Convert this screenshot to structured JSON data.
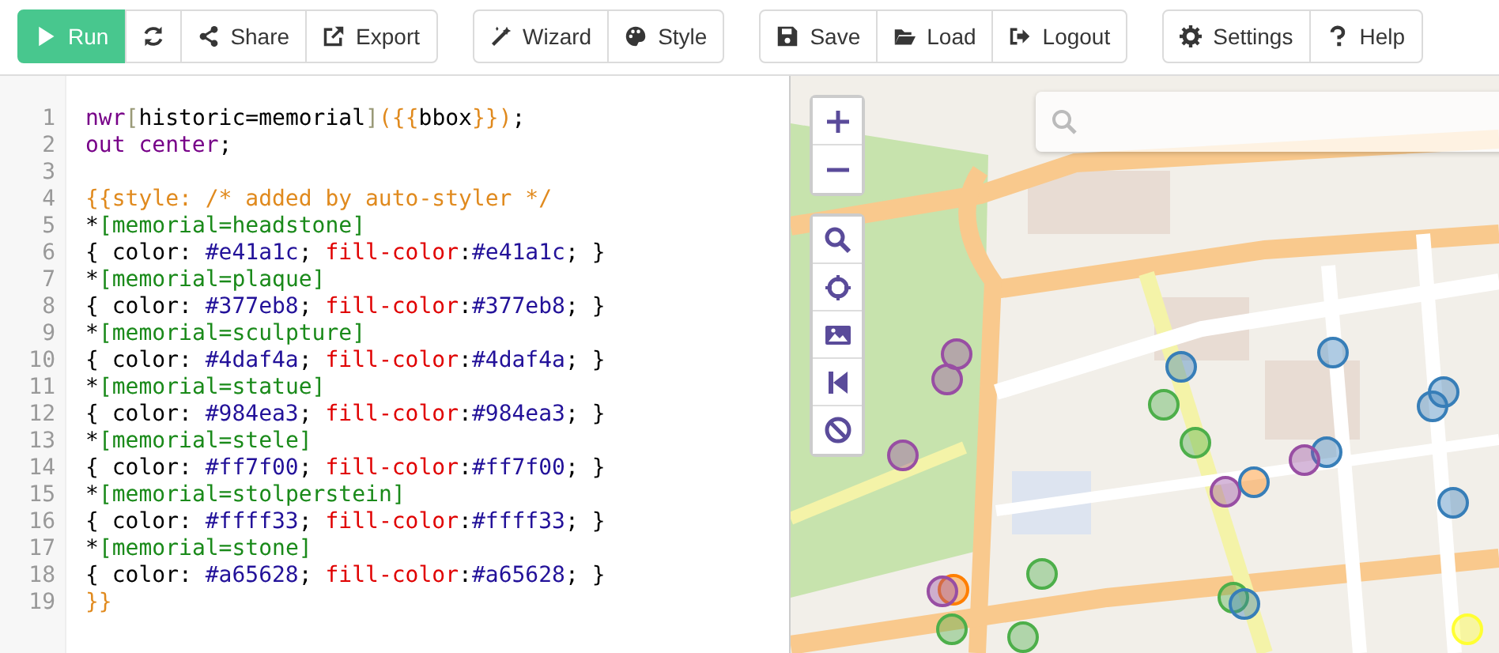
{
  "toolbar": {
    "groups": [
      {
        "buttons": [
          {
            "label": "Run",
            "kind": "primary"
          },
          {
            "kind": "default"
          },
          {
            "label": "Share",
            "kind": "default"
          },
          {
            "label": "Export",
            "kind": "default"
          }
        ]
      },
      {
        "buttons": [
          {
            "label": "Wizard",
            "kind": "default"
          },
          {
            "label": "Style",
            "kind": "default"
          }
        ]
      },
      {
        "buttons": [
          {
            "label": "Save",
            "kind": "default"
          },
          {
            "label": "Load",
            "kind": "default"
          },
          {
            "label": "Logout",
            "kind": "default"
          }
        ]
      },
      {
        "buttons": [
          {
            "label": "Settings",
            "kind": "default"
          },
          {
            "label": "Help",
            "kind": "default"
          }
        ]
      }
    ]
  },
  "editor": {
    "lines": [
      {
        "number": "1",
        "tokens": [
          {
            "text": "nwr",
            "kind": "keyword"
          },
          {
            "text": "[",
            "kind": "bracket"
          },
          {
            "text": "historic=memorial",
            "kind": "plain"
          },
          {
            "text": "]",
            "kind": "bracket"
          },
          {
            "text": "({{",
            "kind": "template"
          },
          {
            "text": "bbox",
            "kind": "plain"
          },
          {
            "text": "}})",
            "kind": "template"
          },
          {
            "text": ";",
            "kind": "plain"
          }
        ]
      },
      {
        "number": "2",
        "tokens": [
          {
            "text": "out center",
            "kind": "keyword"
          },
          {
            "text": ";",
            "kind": "plain"
          }
        ]
      },
      {
        "number": "3"
      },
      {
        "number": "4",
        "tokens": [
          {
            "text": "{{style: /* added by auto-styler */",
            "kind": "template"
          }
        ]
      },
      {
        "number": "5",
        "tokens": [
          {
            "text": "*",
            "kind": "plain"
          },
          {
            "text": "[memorial=headstone]",
            "kind": "selector"
          }
        ]
      },
      {
        "number": "6",
        "tokens": [
          {
            "text": "{ color: ",
            "kind": "plain"
          },
          {
            "text": "#e41a1c",
            "kind": "value"
          },
          {
            "text": "; ",
            "kind": "plain"
          },
          {
            "text": "fill-color",
            "kind": "property"
          },
          {
            "text": ":",
            "kind": "plain"
          },
          {
            "text": "#e41a1c",
            "kind": "value"
          },
          {
            "text": "; }",
            "kind": "plain"
          }
        ]
      },
      {
        "number": "7",
        "tokens": [
          {
            "text": "*",
            "kind": "plain"
          },
          {
            "text": "[memorial=plaque]",
            "kind": "selector"
          }
        ]
      },
      {
        "number": "8",
        "tokens": [
          {
            "text": "{ color: ",
            "kind": "plain"
          },
          {
            "text": "#377eb8",
            "kind": "value"
          },
          {
            "text": "; ",
            "kind": "plain"
          },
          {
            "text": "fill-color",
            "kind": "property"
          },
          {
            "text": ":",
            "kind": "plain"
          },
          {
            "text": "#377eb8",
            "kind": "value"
          },
          {
            "text": "; }",
            "kind": "plain"
          }
        ]
      },
      {
        "number": "9",
        "tokens": [
          {
            "text": "*",
            "kind": "plain"
          },
          {
            "text": "[memorial=sculpture]",
            "kind": "selector"
          }
        ]
      },
      {
        "number": "10",
        "tokens": [
          {
            "text": "{ color: ",
            "kind": "plain"
          },
          {
            "text": "#4daf4a",
            "kind": "value"
          },
          {
            "text": "; ",
            "kind": "plain"
          },
          {
            "text": "fill-color",
            "kind": "property"
          },
          {
            "text": ":",
            "kind": "plain"
          },
          {
            "text": "#4daf4a",
            "kind": "value"
          },
          {
            "text": "; }",
            "kind": "plain"
          }
        ]
      },
      {
        "number": "11",
        "tokens": [
          {
            "text": "*",
            "kind": "plain"
          },
          {
            "text": "[memorial=statue]",
            "kind": "selector"
          }
        ]
      },
      {
        "number": "12",
        "tokens": [
          {
            "text": "{ color: ",
            "kind": "plain"
          },
          {
            "text": "#984ea3",
            "kind": "value"
          },
          {
            "text": "; ",
            "kind": "plain"
          },
          {
            "text": "fill-color",
            "kind": "property"
          },
          {
            "text": ":",
            "kind": "plain"
          },
          {
            "text": "#984ea3",
            "kind": "value"
          },
          {
            "text": "; }",
            "kind": "plain"
          }
        ]
      },
      {
        "number": "13",
        "tokens": [
          {
            "text": "*",
            "kind": "plain"
          },
          {
            "text": "[memorial=stele]",
            "kind": "selector"
          }
        ]
      },
      {
        "number": "14",
        "tokens": [
          {
            "text": "{ color: ",
            "kind": "plain"
          },
          {
            "text": "#ff7f00",
            "kind": "value"
          },
          {
            "text": "; ",
            "kind": "plain"
          },
          {
            "text": "fill-color",
            "kind": "property"
          },
          {
            "text": ":",
            "kind": "plain"
          },
          {
            "text": "#ff7f00",
            "kind": "value"
          },
          {
            "text": "; }",
            "kind": "plain"
          }
        ]
      },
      {
        "number": "15",
        "tokens": [
          {
            "text": "*",
            "kind": "plain"
          },
          {
            "text": "[memorial=stolperstein]",
            "kind": "selector"
          }
        ]
      },
      {
        "number": "16",
        "tokens": [
          {
            "text": "{ color: ",
            "kind": "plain"
          },
          {
            "text": "#ffff33",
            "kind": "value"
          },
          {
            "text": "; ",
            "kind": "plain"
          },
          {
            "text": "fill-color",
            "kind": "property"
          },
          {
            "text": ":",
            "kind": "plain"
          },
          {
            "text": "#ffff33",
            "kind": "value"
          },
          {
            "text": "; }",
            "kind": "plain"
          }
        ]
      },
      {
        "number": "17",
        "tokens": [
          {
            "text": "*",
            "kind": "plain"
          },
          {
            "text": "[memorial=stone]",
            "kind": "selector"
          }
        ]
      },
      {
        "number": "18",
        "tokens": [
          {
            "text": "{ color: ",
            "kind": "plain"
          },
          {
            "text": "#a65628",
            "kind": "value"
          },
          {
            "text": "; ",
            "kind": "plain"
          },
          {
            "text": "fill-color",
            "kind": "property"
          },
          {
            "text": ":",
            "kind": "plain"
          },
          {
            "text": "#a65628",
            "kind": "value"
          },
          {
            "text": "; }",
            "kind": "plain"
          }
        ]
      },
      {
        "number": "19",
        "tokens": [
          {
            "text": "}}",
            "kind": "template"
          }
        ]
      }
    ]
  }
}
